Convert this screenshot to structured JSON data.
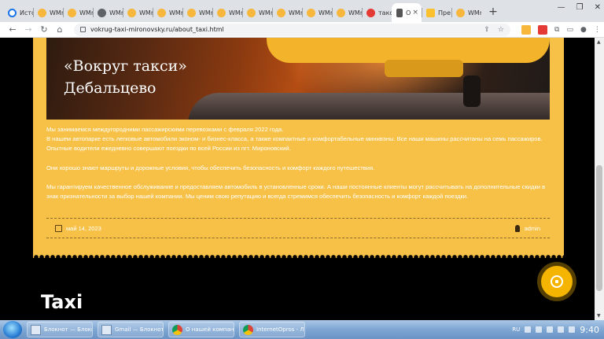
{
  "browser": {
    "tabs": [
      {
        "label": "Исто",
        "favicon": "history-icon"
      },
      {
        "label": "WMr",
        "favicon": "wm-icon"
      },
      {
        "label": "WMr",
        "favicon": "wm-icon"
      },
      {
        "label": "WMr",
        "favicon": "globe-icon"
      },
      {
        "label": "WMr",
        "favicon": "wm-icon"
      },
      {
        "label": "WMr",
        "favicon": "wm-icon"
      },
      {
        "label": "WMr",
        "favicon": "wm-icon"
      },
      {
        "label": "WMr",
        "favicon": "wm-icon"
      },
      {
        "label": "WMr",
        "favicon": "wm-icon"
      },
      {
        "label": "WMr",
        "favicon": "wm-icon"
      },
      {
        "label": "WMr",
        "favicon": "wm-icon"
      },
      {
        "label": "WMr",
        "favicon": "wm-icon"
      },
      {
        "label": "такс",
        "favicon": "red-icon"
      },
      {
        "label": "О",
        "favicon": "pin-icon",
        "active": true
      },
      {
        "label": "Пре",
        "favicon": "yandex-icon"
      },
      {
        "label": "WMr",
        "favicon": "wm-icon"
      }
    ],
    "address": "vokrug-taxi-mironovsky.ru/about_taxi.html"
  },
  "page": {
    "hero_title_line1": "«Вокруг такси»",
    "hero_title_line2": "Дебальцево",
    "paragraph1": "Мы занимаемся междугородними пассажирскими перевозками с февраля 2022 года.\nВ нашем автопарке есть легковые автомобили эконом- и бизнес-класса, а также компактные и комфортабельные минивэны. Все наши машины рассчитаны на семь пассажиров. Опытные водители ежедневно совершают поездки по всей России из пгт. Мироновский.",
    "paragraph2": "Они хорошо знают маршруты и дорожные условия, чтобы обеспечить безопасность и комфорт каждого путешествия.",
    "paragraph3": "Мы гарантируем качественное обслуживание и предоставляем автомобиль в установленные сроки. А наши постоянные клиенты могут рассчитывать на дополнительные скидки в знак признательности за выбор нашей компании. Мы ценим свою репутацию и всегда стремимся обеспечить безопасность и комфорт каждой поездки.",
    "date": "май 14, 2023",
    "author": "admin",
    "footer_heading": "Taxi",
    "accent_color": "#f6c146"
  },
  "taskbar": {
    "items": [
      {
        "label": "Блокнот — Блокн...",
        "icon": "notepad-icon"
      },
      {
        "label": "Gmail — Блокнот",
        "icon": "notepad-icon"
      },
      {
        "label": "О нашей компан...",
        "icon": "chrome-icon"
      },
      {
        "label": "InternetOpros - Л...",
        "icon": "chrome-icon"
      }
    ],
    "lang": "RU",
    "time": "9:40"
  }
}
